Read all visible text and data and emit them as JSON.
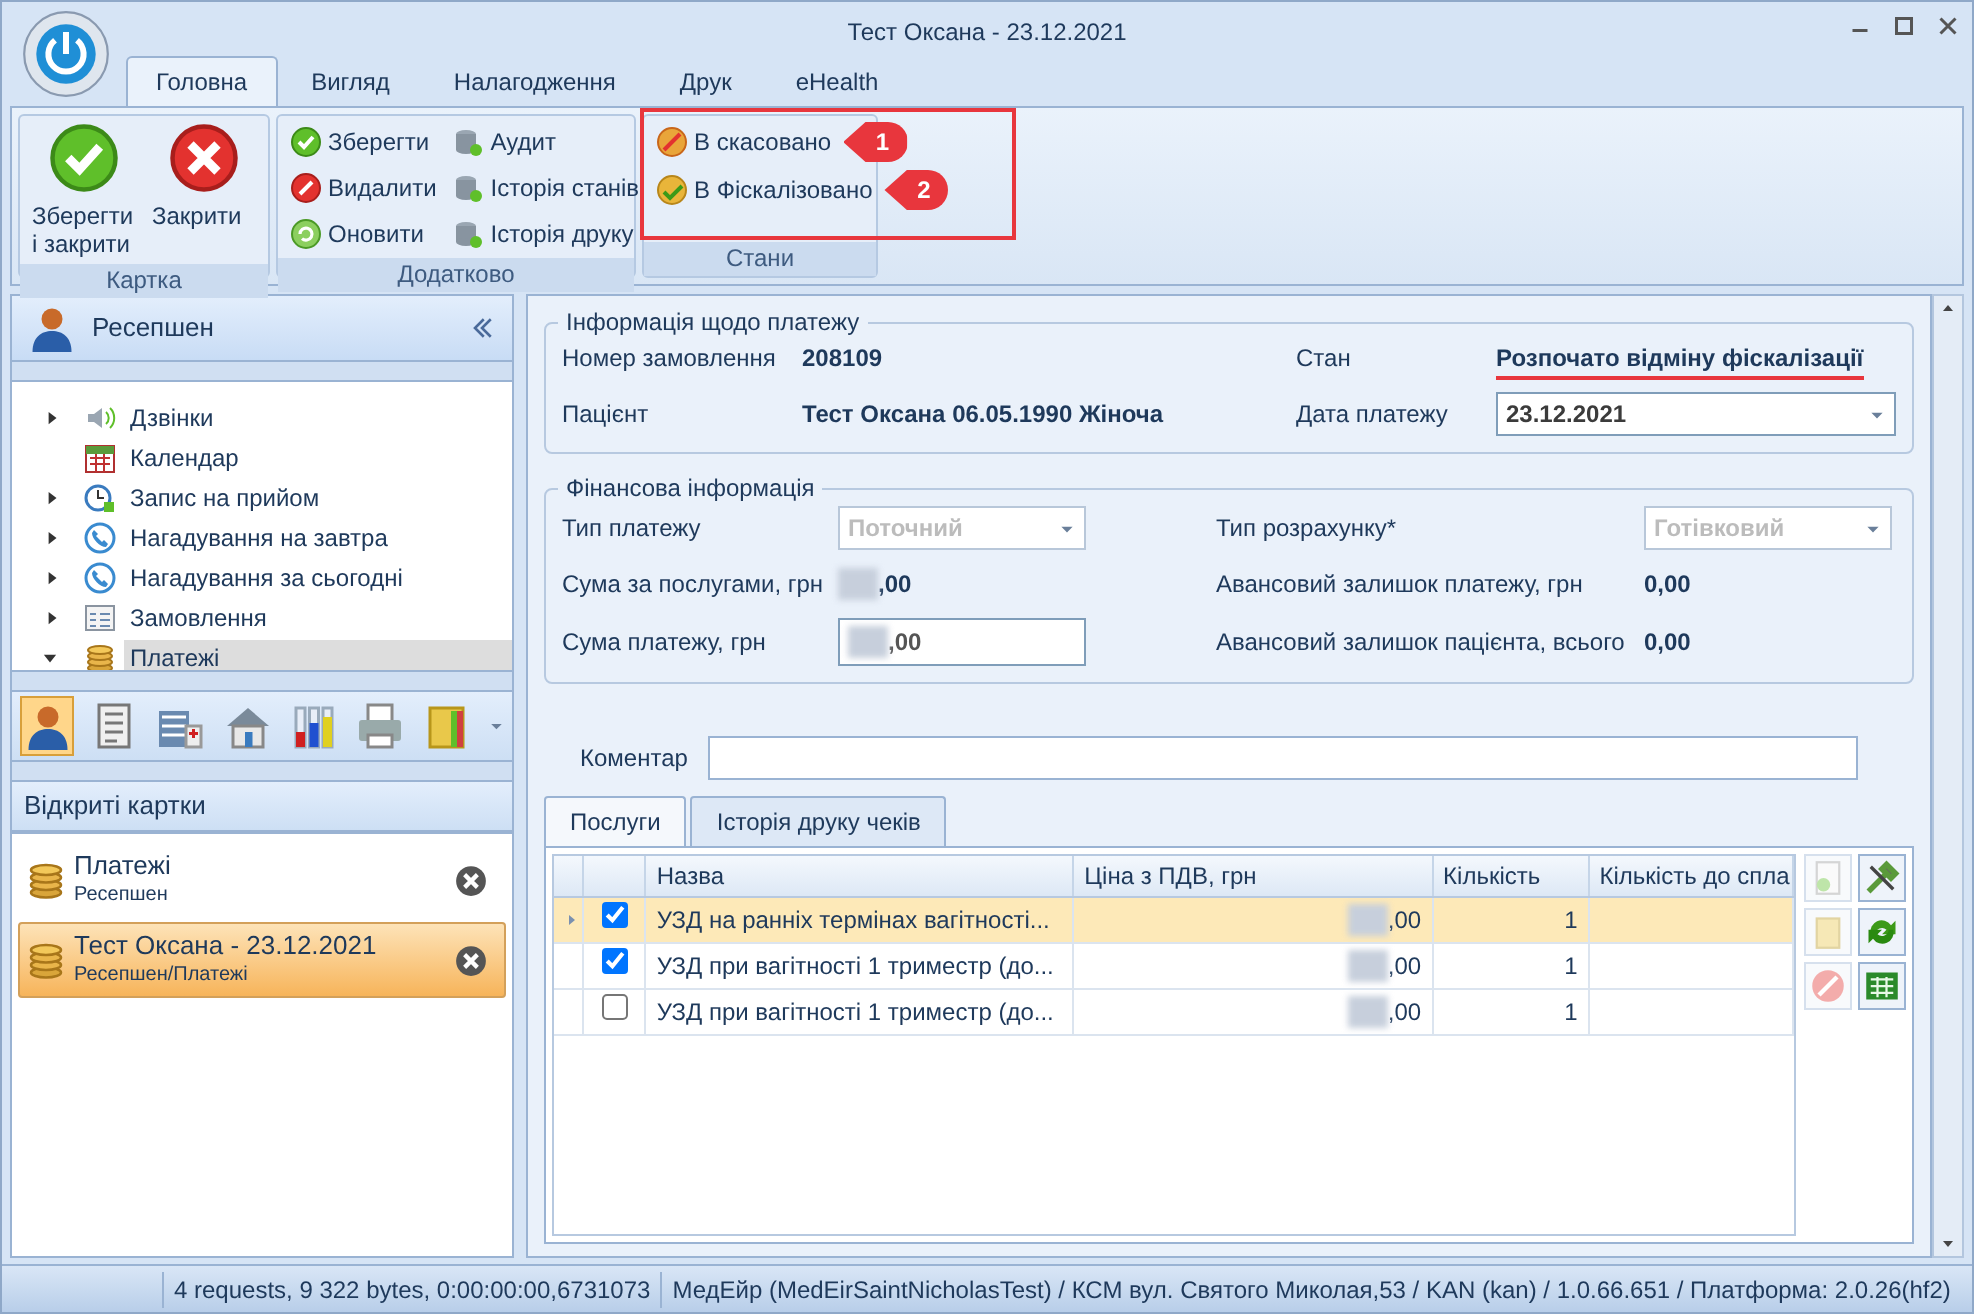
{
  "window": {
    "title": "Тест Оксана - 23.12.2021"
  },
  "ribbon_tabs": [
    {
      "label": "Головна",
      "selected": true
    },
    {
      "label": "Вигляд",
      "selected": false
    },
    {
      "label": "Налагодження",
      "selected": false
    },
    {
      "label": "Друк",
      "selected": false
    },
    {
      "label": "eHealth",
      "selected": false
    }
  ],
  "ribbon_groups": [
    {
      "title": "Картка",
      "highlighted": false,
      "items": [
        {
          "label": "Зберегти і закрити",
          "kind": "large"
        },
        {
          "label": "Закрити",
          "kind": "large"
        }
      ]
    },
    {
      "title": "Додатково",
      "highlighted": false,
      "items": [
        {
          "label": "Зберегти",
          "kind": "small"
        },
        {
          "label": "Видалити",
          "kind": "small"
        },
        {
          "label": "Оновити",
          "kind": "small"
        },
        {
          "label": "Аудит",
          "kind": "small"
        },
        {
          "label": "Історія станів",
          "kind": "small"
        },
        {
          "label": "Історія друку",
          "kind": "small"
        }
      ]
    },
    {
      "title": "Стани",
      "highlighted": true,
      "items": [
        {
          "label": "В скасовано",
          "kind": "small",
          "callout": "1"
        },
        {
          "label": "В Фіскалізовано",
          "kind": "small",
          "callout": "2"
        }
      ]
    }
  ],
  "sidebar": {
    "title": "Ресепшен",
    "nav_items": [
      {
        "label": "Дзвінки",
        "expandable": true,
        "expanded": false,
        "selected": false
      },
      {
        "label": "Календар",
        "expandable": false,
        "selected": false
      },
      {
        "label": "Запис на прийом",
        "expandable": true,
        "expanded": false,
        "selected": false
      },
      {
        "label": "Нагадування на завтра",
        "expandable": true,
        "expanded": false,
        "selected": false
      },
      {
        "label": "Нагадування за сьогодні",
        "expandable": true,
        "expanded": false,
        "selected": false
      },
      {
        "label": "Замовлення",
        "expandable": true,
        "expanded": false,
        "selected": false
      },
      {
        "label": "Платежі",
        "expandable": true,
        "expanded": true,
        "selected": true
      }
    ],
    "toolbar": [
      {
        "selected": true
      },
      {
        "selected": false
      },
      {
        "selected": false
      },
      {
        "selected": false
      },
      {
        "selected": false
      },
      {
        "selected": false
      },
      {
        "selected": false
      }
    ],
    "open_cards_title": "Відкриті картки",
    "open_cards": [
      {
        "title": "Платежі",
        "subtitle": "Ресепшен",
        "selected": false
      },
      {
        "title": "Тест Оксана - 23.12.2021",
        "subtitle": "Ресепшен/Платежі",
        "selected": true
      }
    ]
  },
  "payment_info": {
    "legend": "Інформація щодо платежу",
    "order_label": "Номер замовлення",
    "order_value": "208109",
    "state_label": "Стан",
    "state_value": "Розпочато відміну фіскалізації",
    "state_highlighted": true,
    "patient_label": "Пацієнт",
    "patient_value": "Тест Оксана  06.05.1990 Жіноча",
    "date_label": "Дата платежу",
    "date_value": "23.12.2021"
  },
  "financial_info": {
    "legend": "Фінансова інформація",
    "payment_type_label": "Тип платежу",
    "payment_type_value": "Поточний",
    "payment_type_disabled": true,
    "calc_type_label": "Тип розрахунку*",
    "calc_type_value": "Готівковий",
    "calc_type_disabled": true,
    "services_sum_label": "Сума за послугами, грн",
    "services_sum_value": ",00",
    "advance_payment_label": "Авансовий залишок платежу, грн",
    "advance_payment_value": "0,00",
    "payment_sum_label": "Сума платежу, грн",
    "payment_sum_value": ",00",
    "advance_patient_label": "Авансовий залишок пацієнта, всього",
    "advance_patient_value": "0,00"
  },
  "comment": {
    "label": "Коментар"
  },
  "tabs": [
    {
      "label": "Послуги",
      "selected": true
    },
    {
      "label": "Історія друку чеків",
      "selected": false
    }
  ],
  "table": {
    "columns": [
      "Назва",
      "Ціна з ПДВ, грн",
      "Кількість",
      "Кількість до спла"
    ],
    "rows": [
      {
        "current": true,
        "checked": true,
        "name": "УЗД на ранніх термінах вагітності...",
        "price": ",00",
        "quantity": "1"
      },
      {
        "current": false,
        "checked": true,
        "name": "УЗД при вагітності 1 триместр (до...",
        "price": ",00",
        "quantity": "1"
      },
      {
        "current": false,
        "checked": false,
        "name": "УЗД при вагітності 1 триместр (до...",
        "price": ",00",
        "quantity": "1"
      }
    ]
  },
  "grid_buttons": [
    {
      "disabled": true
    },
    {
      "disabled": false
    },
    {
      "disabled": true
    },
    {
      "disabled": false
    },
    {
      "disabled": true
    },
    {
      "disabled": false
    }
  ],
  "status_bar": [
    "4 requests, 9 322 bytes, 0:00:00:00,6731073",
    "МедЕйр (MedEirSaintNicholasTest) / КСМ вул. Святого Миколая,53 / KAN (kan) / 1.0.66.651 / Платформа: 2.0.26(hf2)"
  ]
}
